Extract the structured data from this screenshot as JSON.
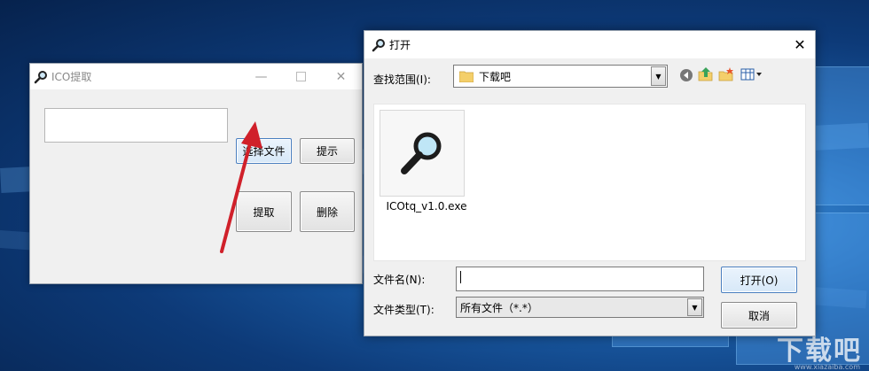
{
  "ico_window": {
    "title": "ICO提取",
    "path_value": "",
    "select_file_label": "选择文件",
    "hint_label": "提示",
    "extract_label": "提取",
    "delete_label": "删除",
    "icons": {
      "title_icon": "magnifier-icon",
      "minimize": "minimize-icon",
      "maximize": "maximize-icon",
      "close": "close-icon"
    }
  },
  "open_dialog": {
    "title": "打开",
    "look_in_label": "查找范围(I):",
    "look_in_value": "下载吧",
    "files": [
      {
        "name": "ICOtq_v1.0.exe",
        "icon": "magnifier-app-icon"
      }
    ],
    "filename_label": "文件名(N):",
    "filename_value": "",
    "filetype_label": "文件类型(T):",
    "filetype_value": "所有文件（*.*）",
    "open_label": "打开(O)",
    "cancel_label": "取消",
    "toolbar_icons": [
      "back-icon",
      "up-folder-icon",
      "new-folder-icon",
      "view-menu-icon"
    ]
  },
  "desktop": {
    "watermark": "下载吧",
    "watermark_url": "www.xiazaiba.com"
  },
  "colors": {
    "desktop_blue": "#1b5ea8",
    "arrow_red": "#d0202a",
    "selected_button_border": "#4a7fc0"
  }
}
